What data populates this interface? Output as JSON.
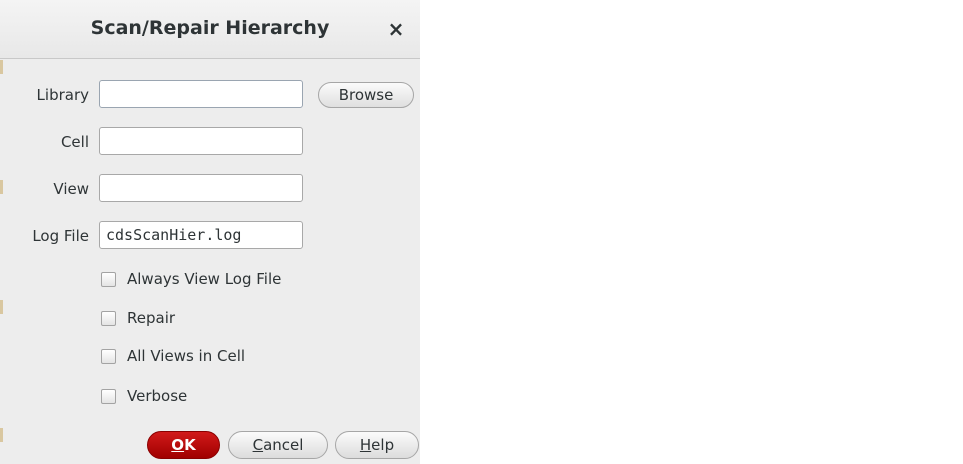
{
  "dialog": {
    "title": "Scan/Repair Hierarchy",
    "close_glyph": "×"
  },
  "fields": [
    {
      "label": "Library",
      "value": "",
      "focused": true
    },
    {
      "label": "Cell",
      "value": ""
    },
    {
      "label": "View",
      "value": ""
    },
    {
      "label": "Log File",
      "value": "cdsScanHier.log"
    }
  ],
  "browse_label": "Browse",
  "options": [
    {
      "label": "Always View Log File",
      "checked": false
    },
    {
      "label": "Repair",
      "checked": false
    },
    {
      "label": "All Views in Cell",
      "checked": false
    },
    {
      "label": "Verbose",
      "checked": false
    }
  ],
  "buttons": {
    "ok": {
      "mnemonic": "O",
      "rest": "K"
    },
    "cancel": {
      "mnemonic": "C",
      "rest": "ancel"
    },
    "help": {
      "mnemonic": "H",
      "rest": "elp"
    }
  },
  "colors": {
    "ok_button": "#c00000",
    "dialog_bg": "#ededed"
  }
}
